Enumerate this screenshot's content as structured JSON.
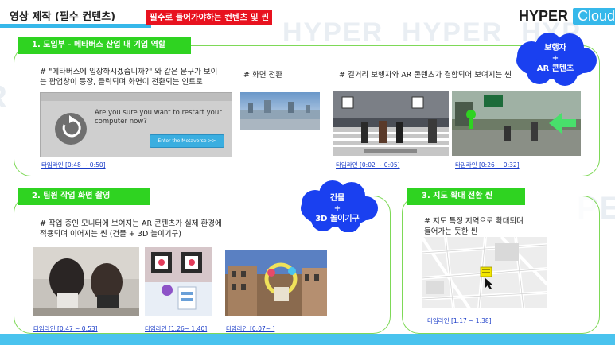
{
  "header": {
    "title": "영상 제작 (필수 컨텐츠)",
    "subtitle": "필수로 들어가야하는 컨텐츠 및 씬",
    "logo_primary": "HYPER",
    "logo_secondary": "Cloud"
  },
  "colors": {
    "accent_green": "#2fd321",
    "panel_border": "#7ed957",
    "accent_blue": "#36b8ea",
    "subtitle_red": "#e8121f",
    "link_blue": "#1a3cc8"
  },
  "section1": {
    "label": "1.      도입부 - 메타버스 산업 내 기업 역할",
    "desc_popup": "# \"메타버스에 입장하시겠습니까?\" 와 같은 문구가 보이는 팝업창이 등장, 클릭되며 화면이 전환되는 인트로",
    "desc_transition": "# 화면 전환",
    "desc_street": "# 길거리 보행자와 AR 콘텐츠가 결합되어 보여지는 씬",
    "dialog_text": "Are you sure you want to restart your computer now?",
    "dialog_button": "Enter the Metaverse     >>",
    "timeline_1": "타임라인 [0:48 ~ 0:50]",
    "timeline_2": "타임라인 [0:02 ~ 0:05]",
    "timeline_3": "타임라인 [0:26 ~ 0:32]",
    "cloud_line1": "보행자",
    "cloud_line2": "+",
    "cloud_line3": "AR 콘텐츠"
  },
  "section2": {
    "label": "2.   팀원 작업 화면 촬영",
    "desc_line1": "# 작업 중인 모니터에 보여지는 AR 콘텐츠가 실제 환경에",
    "desc_line2": "적용되며 이어지는 씬 (건물 + 3D 놀이기구)",
    "timeline_1": "타임라인 [0:47 ~ 0:53]",
    "timeline_2": "타임라인 [1:26~ 1:40]",
    "timeline_3": "타임라인 [0:07~ ]",
    "cloud_line1": "건물",
    "cloud_line2": "+",
    "cloud_line3": "3D 놀이기구"
  },
  "section3": {
    "label": "3.   지도 확대 전환 씬",
    "desc_line1": "# 지도 특정 지역으로 확대되며",
    "desc_line2": "들어가는 듯한 씬",
    "timeline_1": "타임라인 [1:17 ~ 1:38]"
  }
}
